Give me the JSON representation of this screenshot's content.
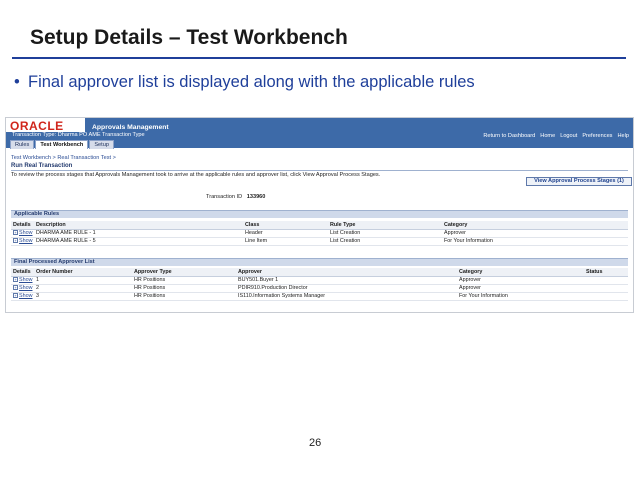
{
  "slide": {
    "title": "Setup Details – Test Workbench",
    "bullet": "Final approver list is displayed along with the applicable rules",
    "page_number": "26"
  },
  "app": {
    "logo": "ORACLE",
    "app_name": "Approvals Management",
    "transaction_type": "Transaction Type: Dharma PO AME Transaction Type",
    "global_links": [
      "Return to Dashboard",
      "Home",
      "Logout",
      "Preferences",
      "Help"
    ],
    "tabs": [
      "Rules",
      "Test Workbench",
      "Setup"
    ],
    "breadcrumb": "Test Workbench  >   Real Transaction Test  >",
    "page_heading": "Run Real Transaction",
    "instruction": "To review the process stages that Approvals Management took to arrive at the applicable rules and approver list, click View Approval Process Stages.",
    "view_button": "View Approval Process Stages (1)",
    "transaction_id_label": "Transaction ID",
    "transaction_id_value": "133960",
    "show_label": "Show",
    "applicable_rules": {
      "title": "Applicable Rules",
      "columns": [
        "Details",
        "Description",
        "Class",
        "Rule Type",
        "Category"
      ],
      "rows": [
        [
          "DHARMA AME RULE - 1",
          "Header",
          "List Creation",
          "Approver"
        ],
        [
          "DHARMA AME RULE - 5",
          "Line Item",
          "List Creation",
          "For Your Information"
        ]
      ]
    },
    "approver_list": {
      "title": "Final Processed Approver List",
      "columns": [
        "Details",
        "Order Number",
        "Approver Type",
        "Approver",
        "Category",
        "Status"
      ],
      "rows": [
        [
          "1",
          "HR Positions",
          "BUY501.Buyer 1",
          "Approver",
          ""
        ],
        [
          "2",
          "HR Positions",
          "PDIR910.Production Director",
          "Approver",
          ""
        ],
        [
          "3",
          "HR Positions",
          "IS110.Information Systems Manager",
          "For Your Information",
          ""
        ]
      ]
    }
  }
}
